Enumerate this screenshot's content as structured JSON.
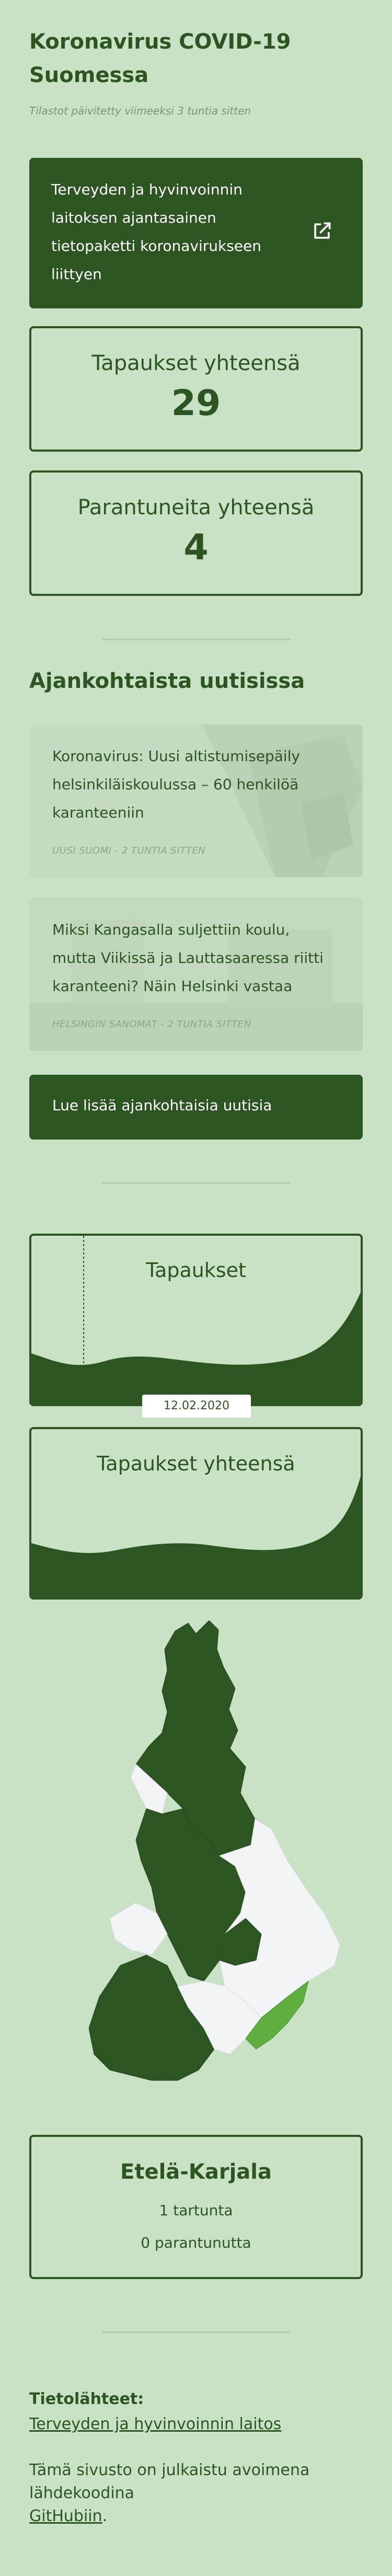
{
  "header": {
    "title": "Koronavirus COVID-19 Suomessa",
    "updated": "Tilastot päivitetty viimeeksi 3 tuntia sitten"
  },
  "thl_card": {
    "text": "Terveyden ja hyvinvoinnin laitoksen ajantasainen tietopaketti koronavirukseen liittyen",
    "icon": "external-link-icon"
  },
  "stats": {
    "cases_label": "Tapaukset yhteensä",
    "cases_value": "29",
    "recovered_label": "Parantuneita yhteensä",
    "recovered_value": "4"
  },
  "news": {
    "section_title": "Ajankohtaista uutisissa",
    "items": [
      {
        "title": "Koronavirus: Uusi altistumisepäily helsinkiläiskoulussa – 60 henkilöä karanteeniin",
        "meta": "UUSI SUOMI - 2 TUNTIA SITTEN"
      },
      {
        "title": "Miksi Kangasalla suljettiin koulu, mutta Viikissä ja Lauttasaaressa riitti karanteeni? Näin Helsinki vastaa",
        "meta": "HELSINGIN SANOMAT - 2 TUNTIA SITTEN"
      }
    ],
    "more_label": "Lue lisää ajankohtaisia uutisia"
  },
  "charts": {
    "daily_title": "Tapaukset",
    "total_title": "Tapaukset yhteensä",
    "selected_date": "12.02.2020"
  },
  "region": {
    "name": "Etelä-Karjala",
    "infections": "1 tartunta",
    "recovered": "0 parantunutta"
  },
  "footer": {
    "sources_label": "Tietolähteet:",
    "sources_link": "Terveyden ja hyvinvoinnin laitos",
    "open_source_text": "Tämä sivusto on julkaistu avoimena lähdekoodina",
    "github_link": "GitHubiin"
  },
  "colors": {
    "background": "#c9e2c5",
    "primary": "#2d5522",
    "highlight_region": "#5fae3f",
    "map_empty": "#f3f4f6"
  }
}
